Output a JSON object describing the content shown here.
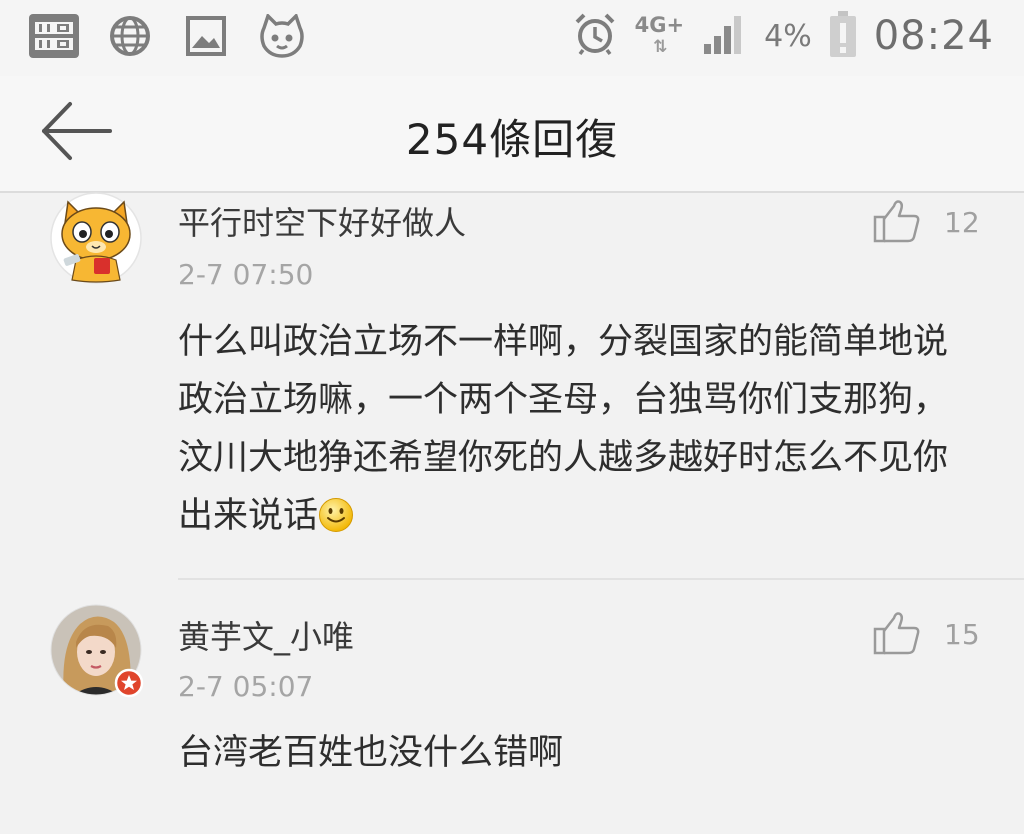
{
  "status_bar": {
    "left_icons": [
      "momo-app-icon",
      "globe-icon",
      "image-icon",
      "cat-app-icon"
    ],
    "alarm_icon": "alarm-clock-icon",
    "network": "4G+",
    "signal_icon": "signal-bars-icon",
    "battery_percent": "4%",
    "battery_icon": "battery-low-icon",
    "time": "08:24"
  },
  "header": {
    "back_icon": "back-arrow-icon",
    "title": "254條回復"
  },
  "comments": [
    {
      "username": "平行时空下好好做人",
      "timestamp": "2-7 07:50",
      "likes": "12",
      "body": "什么叫政治立场不一样啊，分裂国家的能简单地说政治立场嘛，一个两个圣母，台独骂你们支那狗，汶川大地狰还希望你死的人越多越好时怎么不见你出来说话",
      "emoji": "smiley-face-icon",
      "avatar": "cartoon-cat-avatar"
    },
    {
      "username": "黄芋文_小唯",
      "timestamp": "2-7 05:07",
      "likes": "15",
      "body": "台湾老百姓也没什么错啊",
      "avatar": "user-photo-avatar",
      "badge": "verified-star-badge"
    }
  ],
  "colors": {
    "background": "#f2f2f2",
    "header_bg": "#f7f7f7",
    "text_primary": "#2e2e2e",
    "text_secondary": "#a5a5a5",
    "badge_red": "#e0452c"
  }
}
